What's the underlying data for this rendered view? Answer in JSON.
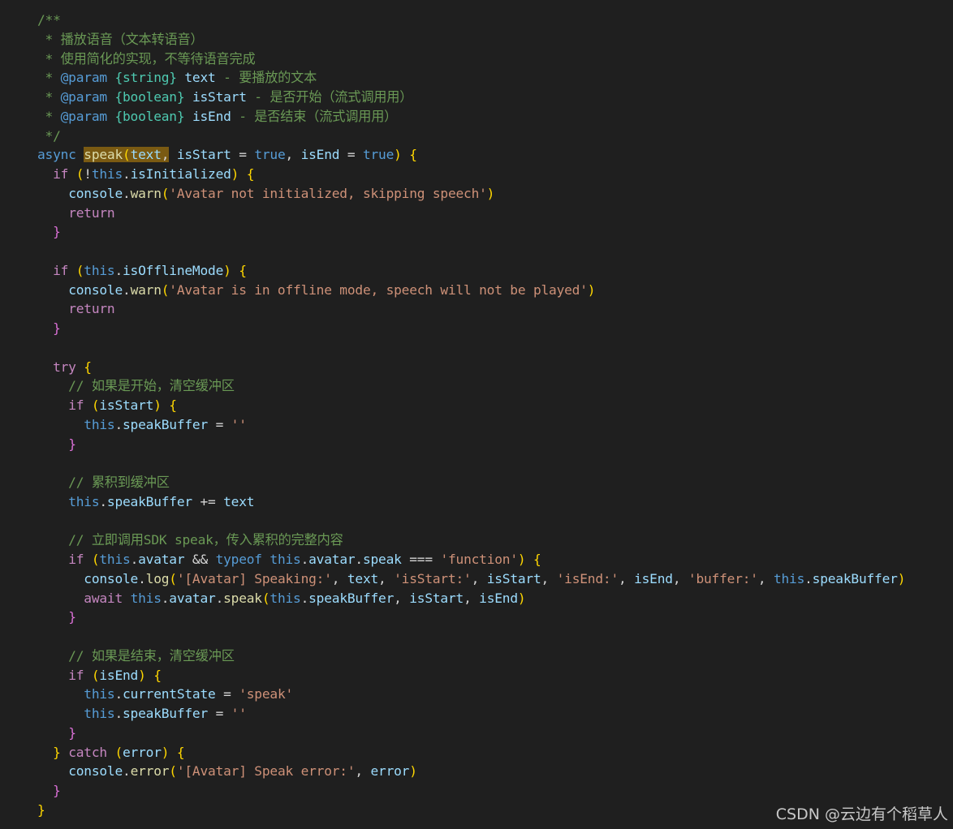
{
  "editor": {
    "theme": "dark",
    "colors": {
      "background": "#1f1f1f",
      "keyword": "#569cd6",
      "control": "#c586c0",
      "function": "#dcdcaa",
      "variable": "#9cdcfe",
      "string": "#ce9178",
      "comment": "#6a9955",
      "type": "#4ec9b0",
      "highlight": "#7a5a12"
    },
    "lines": [
      "/**",
      " * 播放语音（文本转语音）",
      " * 使用简化的实现，不等待语音完成",
      " * @param {string} text - 要播放的文本",
      " * @param {boolean} isStart - 是否开始（流式调用用）",
      " * @param {boolean} isEnd - 是否结束（流式调用用）",
      " */",
      "async speak(text, isStart = true, isEnd = true) {",
      "  if (!this.isInitialized) {",
      "    console.warn('Avatar not initialized, skipping speech')",
      "    return",
      "  }",
      "",
      "  if (this.isOfflineMode) {",
      "    console.warn('Avatar is in offline mode, speech will not be played')",
      "    return",
      "  }",
      "",
      "  try {",
      "    // 如果是开始，清空缓冲区",
      "    if (isStart) {",
      "      this.speakBuffer = ''",
      "    }",
      "",
      "    // 累积到缓冲区",
      "    this.speakBuffer += text",
      "",
      "    // 立即调用SDK speak，传入累积的完整内容",
      "    if (this.avatar && typeof this.avatar.speak === 'function') {",
      "      console.log('[Avatar] Speaking:', text, 'isStart:', isStart, 'isEnd:', isEnd, 'buffer:', this.speakBuffer)",
      "      await this.avatar.speak(this.speakBuffer, isStart, isEnd)",
      "    }",
      "",
      "    // 如果是结束，清空缓冲区",
      "    if (isEnd) {",
      "      this.currentState = 'speak'",
      "      this.speakBuffer = ''",
      "    }",
      "  } catch (error) {",
      "    console.error('[Avatar] Speak error:', error)",
      "  }",
      "}"
    ]
  },
  "watermark": "CSDN @云边有个稻草人"
}
